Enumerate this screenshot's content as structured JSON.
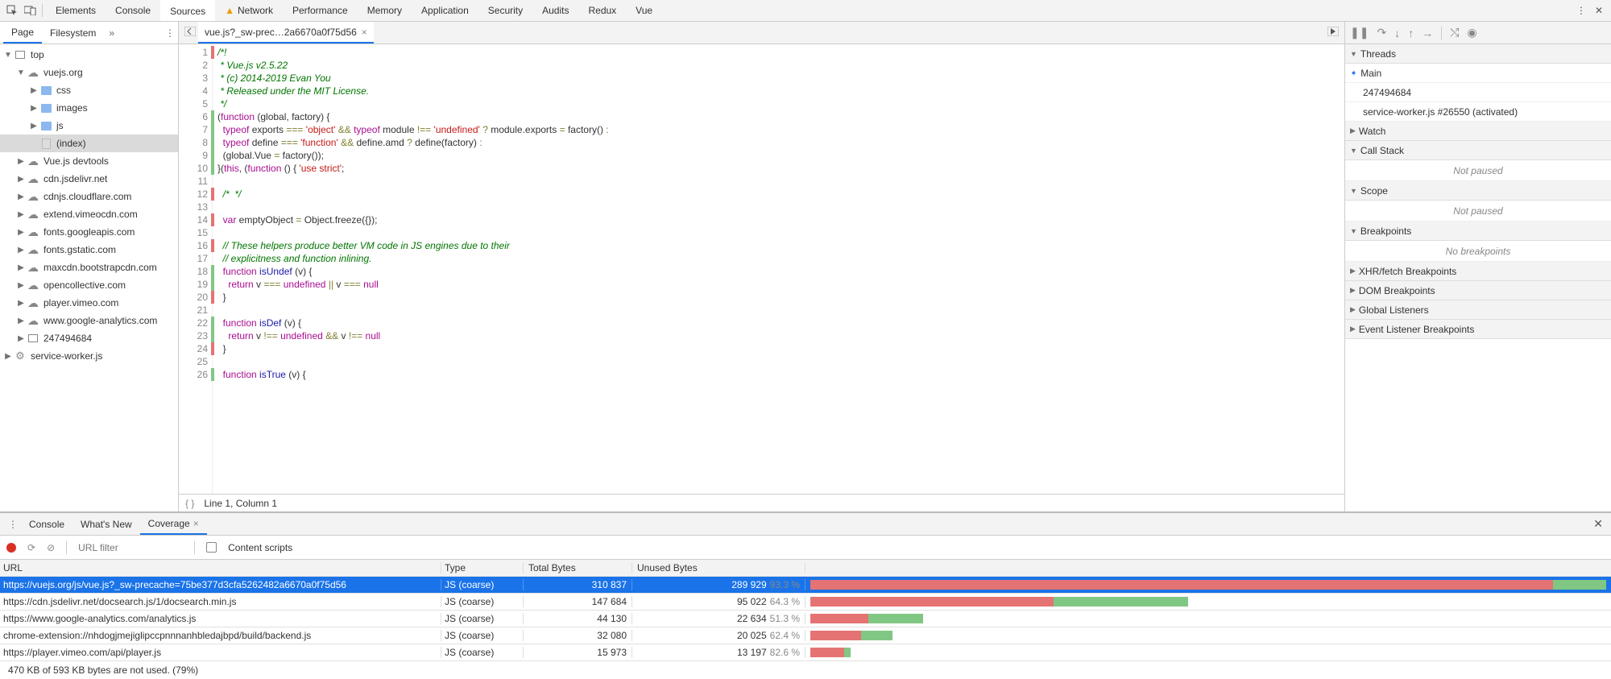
{
  "toolbar": {
    "tabs": [
      "Elements",
      "Console",
      "Sources",
      "Network",
      "Performance",
      "Memory",
      "Application",
      "Security",
      "Audits",
      "Redux",
      "Vue"
    ],
    "active": "Sources",
    "warning_on": "Network"
  },
  "sidebar": {
    "tabs": [
      "Page",
      "Filesystem"
    ],
    "active": "Page",
    "tree": [
      {
        "depth": 0,
        "kind": "frame",
        "label": "top",
        "expanded": true
      },
      {
        "depth": 1,
        "kind": "cloud",
        "label": "vuejs.org",
        "expanded": true
      },
      {
        "depth": 2,
        "kind": "folder",
        "label": "css",
        "expanded": false
      },
      {
        "depth": 2,
        "kind": "folder",
        "label": "images",
        "expanded": false
      },
      {
        "depth": 2,
        "kind": "folder",
        "label": "js",
        "expanded": false
      },
      {
        "depth": 2,
        "kind": "file",
        "label": "(index)",
        "selected": true
      },
      {
        "depth": 1,
        "kind": "cloud",
        "label": "Vue.js devtools",
        "expanded": false
      },
      {
        "depth": 1,
        "kind": "cloud",
        "label": "cdn.jsdelivr.net",
        "expanded": false
      },
      {
        "depth": 1,
        "kind": "cloud",
        "label": "cdnjs.cloudflare.com",
        "expanded": false
      },
      {
        "depth": 1,
        "kind": "cloud",
        "label": "extend.vimeocdn.com",
        "expanded": false
      },
      {
        "depth": 1,
        "kind": "cloud",
        "label": "fonts.googleapis.com",
        "expanded": false
      },
      {
        "depth": 1,
        "kind": "cloud",
        "label": "fonts.gstatic.com",
        "expanded": false
      },
      {
        "depth": 1,
        "kind": "cloud",
        "label": "maxcdn.bootstrapcdn.com",
        "expanded": false
      },
      {
        "depth": 1,
        "kind": "cloud",
        "label": "opencollective.com",
        "expanded": false
      },
      {
        "depth": 1,
        "kind": "cloud",
        "label": "player.vimeo.com",
        "expanded": false
      },
      {
        "depth": 1,
        "kind": "cloud",
        "label": "www.google-analytics.com",
        "expanded": false
      },
      {
        "depth": 1,
        "kind": "frame",
        "label": "247494684",
        "expanded": false
      },
      {
        "depth": 0,
        "kind": "gear",
        "label": "service-worker.js",
        "expanded": false
      }
    ]
  },
  "file_tab": {
    "name": "vue.js?_sw-prec…2a6670a0f75d56"
  },
  "code_lines": [
    {
      "n": 1,
      "cov": "red",
      "html": "<span class='c-com'>/*!</span>"
    },
    {
      "n": 2,
      "cov": "",
      "html": "<span class='c-com'> * Vue.js v2.5.22</span>"
    },
    {
      "n": 3,
      "cov": "",
      "html": "<span class='c-com'> * (c) 2014-2019 Evan You</span>"
    },
    {
      "n": 4,
      "cov": "",
      "html": "<span class='c-com'> * Released under the MIT License.</span>"
    },
    {
      "n": 5,
      "cov": "",
      "html": "<span class='c-com'> */</span>"
    },
    {
      "n": 6,
      "cov": "green",
      "html": "<span class='c-pl'>(</span><span class='c-kw'>function</span> <span class='c-pl'>(global, factory) {</span>"
    },
    {
      "n": 7,
      "cov": "green",
      "html": "  <span class='c-kw'>typeof</span> exports <span class='c-op'>===</span> <span class='c-str'>'object'</span> <span class='c-op'>&amp;&amp;</span> <span class='c-kw'>typeof</span> module <span class='c-op'>!==</span> <span class='c-str'>'undefined'</span> <span class='c-op'>?</span> module.exports <span class='c-op'>=</span> factory() <span class='c-op'>:</span>"
    },
    {
      "n": 8,
      "cov": "green",
      "html": "  <span class='c-kw'>typeof</span> define <span class='c-op'>===</span> <span class='c-str'>'function'</span> <span class='c-op'>&amp;&amp;</span> define.amd <span class='c-op'>?</span> define(factory) <span class='c-op'>:</span>"
    },
    {
      "n": 9,
      "cov": "green",
      "html": "  (global.Vue <span class='c-op'>=</span> factory());"
    },
    {
      "n": 10,
      "cov": "green",
      "html": "}(<span class='c-kw'>this</span>, (<span class='c-kw'>function</span> () { <span class='c-str'>'use strict'</span>;"
    },
    {
      "n": 11,
      "cov": "",
      "html": ""
    },
    {
      "n": 12,
      "cov": "red",
      "html": "  <span class='c-com'>/*  */</span>"
    },
    {
      "n": 13,
      "cov": "",
      "html": ""
    },
    {
      "n": 14,
      "cov": "red",
      "html": "  <span class='c-kw'>var</span> emptyObject <span class='c-op'>=</span> Object.freeze({});"
    },
    {
      "n": 15,
      "cov": "",
      "html": ""
    },
    {
      "n": 16,
      "cov": "red",
      "html": "  <span class='c-com'>// These helpers produce better VM code in JS engines due to their</span>"
    },
    {
      "n": 17,
      "cov": "",
      "html": "  <span class='c-com'>// explicitness and function inlining.</span>"
    },
    {
      "n": 18,
      "cov": "green",
      "html": "  <span class='c-kw'>function</span> <span class='c-fn'>isUndef</span> (v) {"
    },
    {
      "n": 19,
      "cov": "green",
      "html": "    <span class='c-kw'>return</span> v <span class='c-op'>===</span> <span class='c-kw'>undefined</span> <span class='c-op'>||</span> v <span class='c-op'>===</span> <span class='c-kw'>null</span>"
    },
    {
      "n": 20,
      "cov": "red",
      "html": "  }"
    },
    {
      "n": 21,
      "cov": "",
      "html": ""
    },
    {
      "n": 22,
      "cov": "green",
      "html": "  <span class='c-kw'>function</span> <span class='c-fn'>isDef</span> (v) {"
    },
    {
      "n": 23,
      "cov": "green",
      "html": "    <span class='c-kw'>return</span> v <span class='c-op'>!==</span> <span class='c-kw'>undefined</span> <span class='c-op'>&amp;&amp;</span> v <span class='c-op'>!==</span> <span class='c-kw'>null</span>"
    },
    {
      "n": 24,
      "cov": "red",
      "html": "  }"
    },
    {
      "n": 25,
      "cov": "",
      "html": ""
    },
    {
      "n": 26,
      "cov": "green",
      "html": "  <span class='c-kw'>function</span> <span class='c-fn'>isTrue</span> (v) {"
    }
  ],
  "status": {
    "cursor": "Line 1, Column 1"
  },
  "right": {
    "threads": {
      "title": "Threads",
      "items": [
        "Main",
        "247494684",
        "service-worker.js #26550 (activated)"
      ]
    },
    "watch": {
      "title": "Watch"
    },
    "callstack": {
      "title": "Call Stack",
      "placeholder": "Not paused"
    },
    "scope": {
      "title": "Scope",
      "placeholder": "Not paused"
    },
    "breakpoints": {
      "title": "Breakpoints",
      "placeholder": "No breakpoints"
    },
    "xhr": {
      "title": "XHR/fetch Breakpoints"
    },
    "dom": {
      "title": "DOM Breakpoints"
    },
    "global": {
      "title": "Global Listeners"
    },
    "event": {
      "title": "Event Listener Breakpoints"
    }
  },
  "drawer": {
    "tabs": [
      "Console",
      "What's New",
      "Coverage"
    ],
    "active": "Coverage",
    "filter_placeholder": "URL filter",
    "content_scripts": "Content scripts",
    "columns": [
      "URL",
      "Type",
      "Total Bytes",
      "Unused Bytes"
    ],
    "rows": [
      {
        "url": "https://vuejs.org/js/vue.js?_sw-precache=75be377d3cfa5262482a6670a0f75d56",
        "type": "JS (coarse)",
        "total": "310 837",
        "unused": "289 929",
        "pct": "93.3 %",
        "bar_total": 100,
        "bar_unused": 93.3,
        "sel": true
      },
      {
        "url": "https://cdn.jsdelivr.net/docsearch.js/1/docsearch.min.js",
        "type": "JS (coarse)",
        "total": "147 684",
        "unused": "95 022",
        "pct": "64.3 %",
        "bar_total": 47.5,
        "bar_unused": 64.3
      },
      {
        "url": "https://www.google-analytics.com/analytics.js",
        "type": "JS (coarse)",
        "total": "44 130",
        "unused": "22 634",
        "pct": "51.3 %",
        "bar_total": 14.2,
        "bar_unused": 51.3
      },
      {
        "url": "chrome-extension://nhdogjmejiglipccpnnnanhbledajbpd/build/backend.js",
        "type": "JS (coarse)",
        "total": "32 080",
        "unused": "20 025",
        "pct": "62.4 %",
        "bar_total": 10.3,
        "bar_unused": 62.4
      },
      {
        "url": "https://player.vimeo.com/api/player.js",
        "type": "JS (coarse)",
        "total": "15 973",
        "unused": "13 197",
        "pct": "82.6 %",
        "bar_total": 5.1,
        "bar_unused": 82.6
      }
    ],
    "summary": "470 KB of 593 KB bytes are not used. (79%)"
  }
}
